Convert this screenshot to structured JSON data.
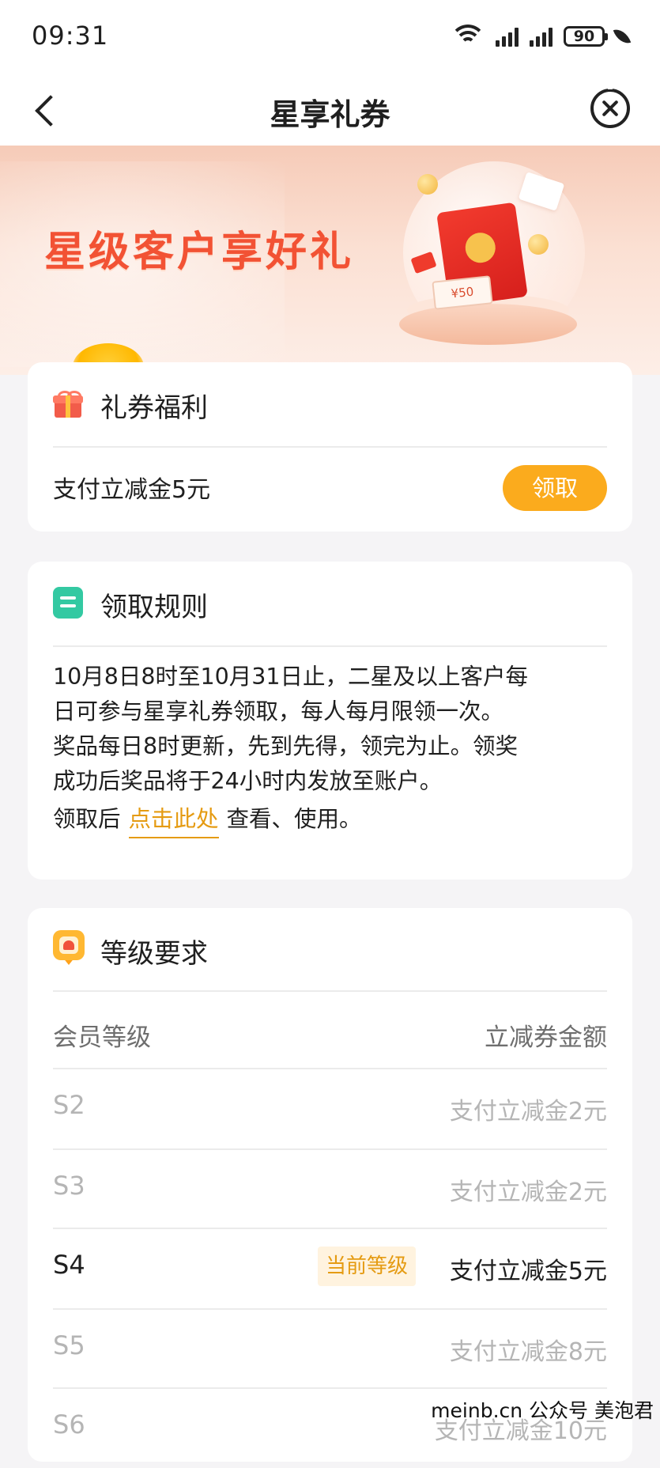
{
  "status_bar": {
    "time": "09:31",
    "battery": "90"
  },
  "nav": {
    "title": "星享礼券"
  },
  "banner": {
    "title": "星级客户享好礼",
    "coupon_text": "¥50"
  },
  "benefit_card": {
    "title": "礼券福利",
    "item_name": "支付立减金5元",
    "claim_label": "领取"
  },
  "rules_card": {
    "title": "领取规则",
    "line1": "10月8日8时至10月31日止，二星及以上客户每",
    "line2": "日可参与星享礼券领取，每人每月限领一次。",
    "line3": "奖品每日8时更新，先到先得，领完为止。领奖",
    "line4": "成功后奖品将于24小时内发放至账户。",
    "line5_prefix": "领取后",
    "line5_link": "点击此处",
    "line5_suffix": "查看、使用。"
  },
  "level_card": {
    "title": "等级要求",
    "col_level": "会员等级",
    "col_amount": "立减券金额",
    "current_tag": "当前等级",
    "rows": [
      {
        "level": "S2",
        "amount": "支付立减金2元"
      },
      {
        "level": "S3",
        "amount": "支付立减金2元"
      },
      {
        "level": "S4",
        "amount": "支付立减金5元"
      },
      {
        "level": "S5",
        "amount": "支付立减金8元"
      },
      {
        "level": "S6",
        "amount": "支付立减金10元"
      }
    ]
  },
  "watermark": "meinb.cn 公众号 美泡君",
  "colors": {
    "accent": "#fbab1d",
    "link": "#e59b12",
    "banner_title": "#f25234"
  }
}
